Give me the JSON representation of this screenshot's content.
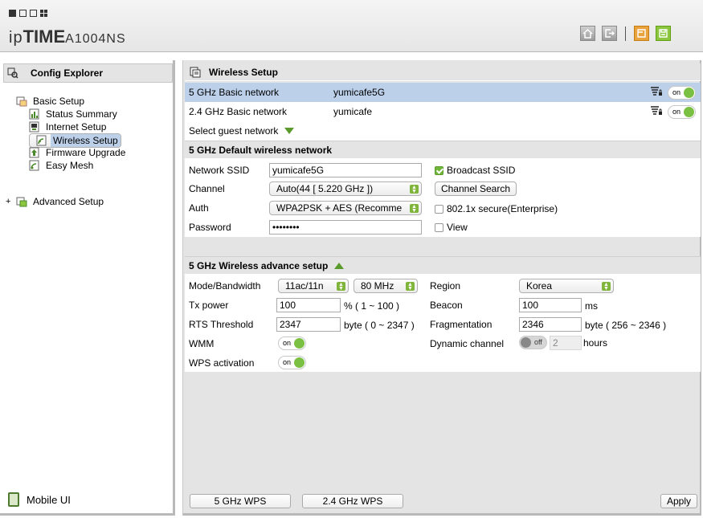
{
  "header": {
    "logo_prefix": "ip",
    "logo_bold": "TIME",
    "model": "A1004NS",
    "icons": [
      "home-icon",
      "logout-icon",
      "restore-icon",
      "save-icon"
    ]
  },
  "left": {
    "title": "Config Explorer",
    "basic_setup": "Basic Setup",
    "items": [
      "Status Summary",
      "Internet Setup",
      "Wireless Setup",
      "Firmware Upgrade",
      "Easy Mesh"
    ],
    "advanced_setup": "Advanced Setup",
    "mobile_ui": "Mobile UI"
  },
  "right": {
    "title": "Wireless Setup",
    "networks": [
      {
        "band": "5 GHz Basic network",
        "ssid": "yumicafe5G",
        "toggle": "on"
      },
      {
        "band": "2.4 GHz Basic network",
        "ssid": "yumicafe",
        "toggle": "on"
      }
    ],
    "guest_label": "Select guest network",
    "default_section": "5 GHz Default wireless network",
    "ssid_label": "Network SSID",
    "ssid_value": "yumicafe5G",
    "broadcast_label": "Broadcast SSID",
    "channel_label": "Channel",
    "channel_value": "Auto(44 [ 5.220 GHz ])",
    "channel_search": "Channel Search",
    "auth_label": "Auth",
    "auth_value": "WPA2PSK + AES (Recomme",
    "secure_label": "802.1x secure(Enterprise)",
    "password_label": "Password",
    "password_value": "••••••••",
    "view_label": "View",
    "advance_section": "5 GHz Wireless advance setup",
    "mode_label": "Mode/Bandwidth",
    "mode_value": "11ac/11n",
    "bandwidth_value": "80 MHz",
    "region_label": "Region",
    "region_value": "Korea",
    "tx_label": "Tx power",
    "tx_value": "100",
    "tx_range": "% ( 1 ~ 100 )",
    "beacon_label": "Beacon",
    "beacon_value": "100",
    "beacon_unit": "ms",
    "rts_label": "RTS Threshold",
    "rts_value": "2347",
    "rts_range": "byte ( 0 ~ 2347 )",
    "frag_label": "Fragmentation",
    "frag_value": "2346",
    "frag_range": "byte ( 256 ~ 2346 )",
    "wmm_label": "WMM",
    "wmm_toggle": "on",
    "dyn_label": "Dynamic channel",
    "dyn_toggle": "off",
    "dyn_value": "2",
    "dyn_unit": "hours",
    "wps_label": "WPS activation",
    "wps_toggle": "on",
    "btn_5g_wps": "5 GHz WPS",
    "btn_24g_wps": "2.4 GHz WPS",
    "btn_apply": "Apply"
  }
}
